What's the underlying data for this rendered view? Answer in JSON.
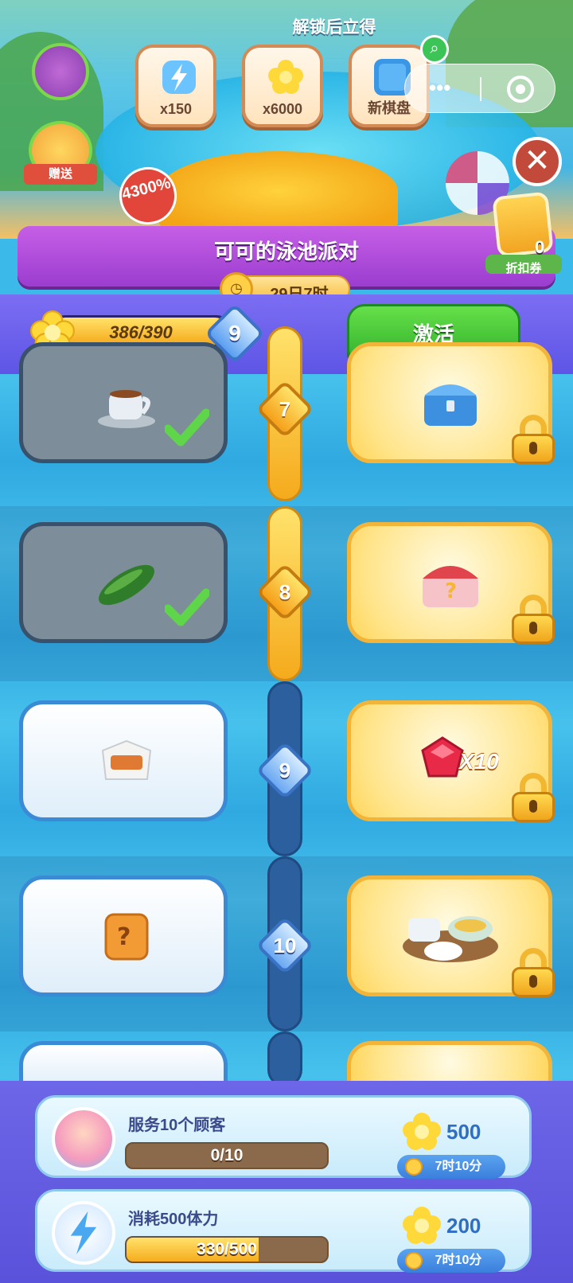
{
  "banner": {
    "unlock_title": "解锁后立得",
    "rewards": [
      {
        "label": "x150",
        "icon": "energy-bolt-icon"
      },
      {
        "label": "x6000",
        "icon": "flower-coin-icon"
      },
      {
        "label": "新棋盘",
        "icon": "new-board-icon"
      }
    ],
    "gift_label": "赠送",
    "bonus_percent": "4300%"
  },
  "event": {
    "title": "可可的泳池派对",
    "timer": "29日7时",
    "coupon_count": "0",
    "coupon_label": "折扣券"
  },
  "progress": {
    "points": "386/390",
    "fraction": 0.99,
    "level": "9",
    "activate_label": "激活"
  },
  "tiers": [
    {
      "level": "7",
      "free_item": "tea-cup-icon",
      "claimed": true,
      "premium_item": "blue-chest-icon",
      "premium_qty": ""
    },
    {
      "level": "8",
      "free_item": "cucumber-icon",
      "claimed": true,
      "premium_item": "red-mystery-chest-icon",
      "premium_qty": ""
    },
    {
      "level": "9",
      "free_item": "takeout-box-icon",
      "claimed": false,
      "premium_item": "ruby-gem-icon",
      "premium_qty": "X10"
    },
    {
      "level": "10",
      "free_item": "mystery-cube-icon",
      "claimed": false,
      "premium_item": "breakfast-set-icon",
      "premium_qty": ""
    }
  ],
  "tasks": [
    {
      "title": "服务10个顾客",
      "progress": "0/10",
      "fraction": 0.0,
      "reward": "500",
      "time": "7时10分",
      "icon": "avatar"
    },
    {
      "title": "消耗500体力",
      "progress": "330/500",
      "fraction": 0.66,
      "reward": "200",
      "time": "7时10分",
      "icon": "energy-bolt-icon"
    }
  ],
  "colors": {
    "accent_green": "#2fae2a",
    "event_purple": "#9b3dd0",
    "gold": "#f5aa1c"
  }
}
